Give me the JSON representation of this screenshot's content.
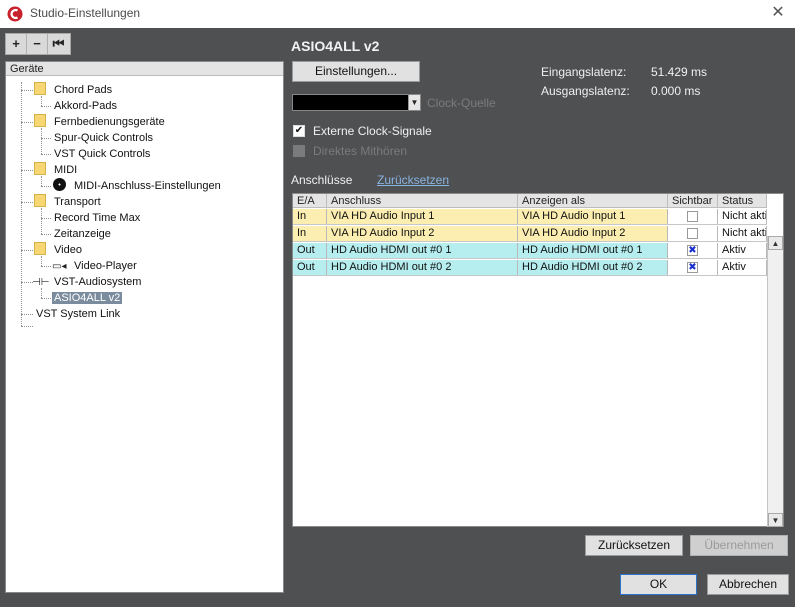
{
  "window": {
    "title": "Studio-Einstellungen",
    "close_glyph": "✕"
  },
  "toolbar": {
    "add_label": "+",
    "remove_label": "−",
    "reset_label": "⏮"
  },
  "tree": {
    "header": "Geräte",
    "items": [
      {
        "label": "Chord Pads"
      },
      {
        "label": "Akkord-Pads"
      },
      {
        "label": "Fernbedienungsgeräte"
      },
      {
        "label": "Spur-Quick Controls"
      },
      {
        "label": "VST Quick Controls"
      },
      {
        "label": "MIDI"
      },
      {
        "label": "MIDI-Anschluss-Einstellungen"
      },
      {
        "label": "Transport"
      },
      {
        "label": "Record Time Max"
      },
      {
        "label": "Zeitanzeige"
      },
      {
        "label": "Video"
      },
      {
        "label": "Video-Player"
      },
      {
        "label": "VST-Audiosystem"
      },
      {
        "label": "ASIO4ALL v2"
      },
      {
        "label": "VST System Link"
      }
    ]
  },
  "main": {
    "heading": "ASIO4ALL v2",
    "settings_button": "Einstellungen...",
    "input_latency_label": "Eingangslatenz:",
    "input_latency_value": "51.429 ms",
    "output_latency_label": "Ausgangslatenz:",
    "output_latency_value": "0.000 ms",
    "clock_label": "Clock-Quelle",
    "external_clock_label": "Externe Clock-Signale",
    "direct_monitoring_label": "Direktes Mithören",
    "connections_label": "Anschlüsse",
    "reset_link": "Zurücksetzen",
    "columns": [
      "E/A",
      "Anschluss",
      "Anzeigen als",
      "Sichtbar",
      "Status"
    ],
    "rows": [
      {
        "io": "In",
        "port": "VIA HD Audio Input 1",
        "display": "VIA HD Audio Input 1",
        "visible": false,
        "status": "Nicht akti"
      },
      {
        "io": "In",
        "port": "VIA HD Audio Input 2",
        "display": "VIA HD Audio Input 2",
        "visible": false,
        "status": "Nicht akti"
      },
      {
        "io": "Out",
        "port": "HD Audio HDMI out #0 1",
        "display": "HD Audio HDMI out #0 1",
        "visible": true,
        "status": "Aktiv"
      },
      {
        "io": "Out",
        "port": "HD Audio HDMI out #0 2",
        "display": "HD Audio HDMI out #0 2",
        "visible": true,
        "status": "Aktiv"
      }
    ],
    "reset_button": "Zurücksetzen",
    "apply_button": "Übernehmen"
  },
  "footer": {
    "ok_button": "OK",
    "cancel_button": "Abbrechen"
  },
  "colors": {
    "input_row": "#fbeeb0",
    "output_row": "#b6eef0",
    "folder": "#f7d774"
  }
}
